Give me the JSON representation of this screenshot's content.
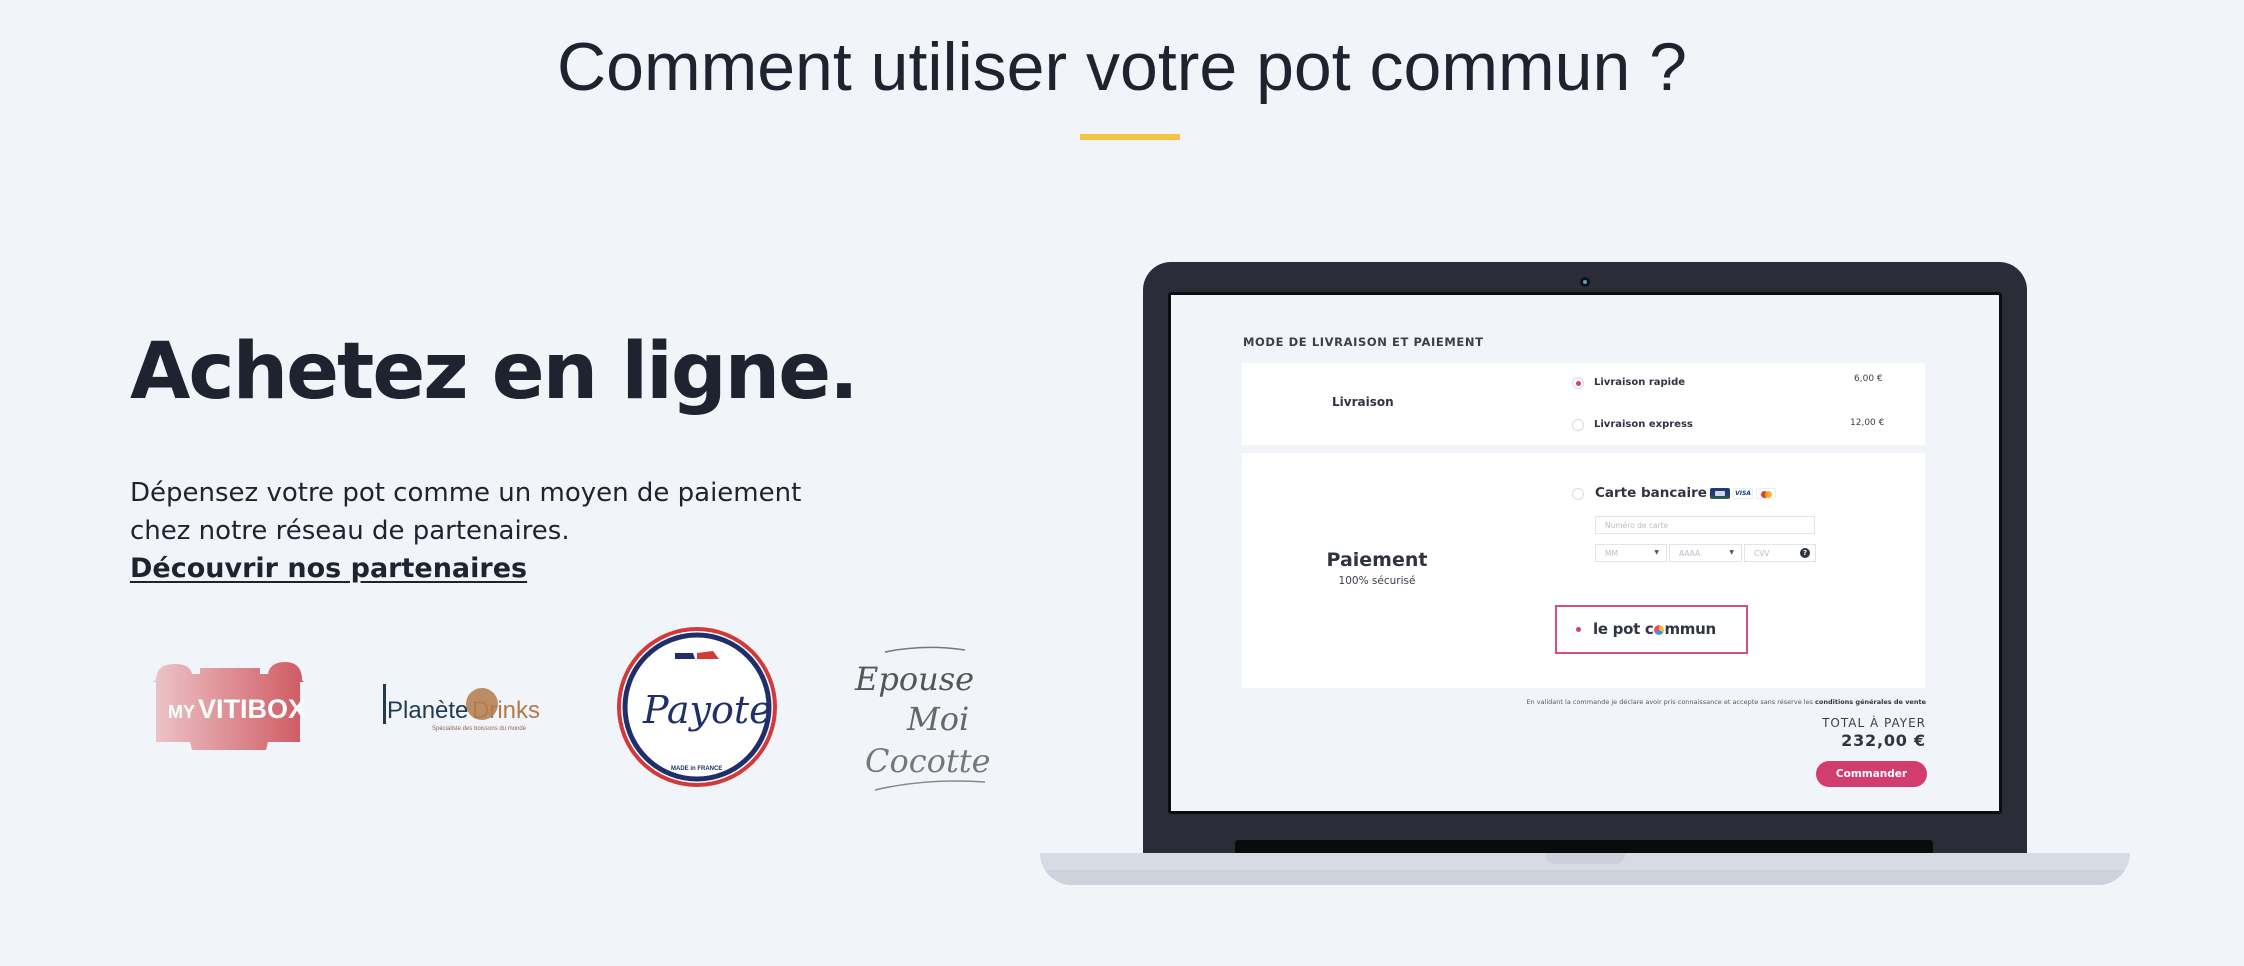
{
  "section": {
    "title": "Comment utiliser votre pot commun ?",
    "accent_color": "#f4c542"
  },
  "left": {
    "headline": "Achetez en ligne.",
    "description_line1": "Dépensez votre pot comme un moyen de paiement",
    "description_line2": "chez notre réseau de partenaires.",
    "partners_link": "Découvrir nos partenaires"
  },
  "partners": [
    {
      "name": "My Vitibox",
      "line1": "MY",
      "line2": "VITIBOX"
    },
    {
      "name": "Planète Drinks",
      "word1": "Planète",
      "word2": "Drinks",
      "tagline": "Spécialiste des boissons du monde"
    },
    {
      "name": "Payote",
      "script": "Payote",
      "made_in": "MADE in FRANCE"
    },
    {
      "name": "Epouse Moi Cocotte",
      "line1": "Epouse",
      "line2": "Moi",
      "line3": "Cocotte"
    }
  ],
  "checkout": {
    "title": "MODE DE LIVRAISON ET PAIEMENT",
    "delivery": {
      "label": "Livraison",
      "options": [
        {
          "label": "Livraison rapide",
          "price": "6,00 €",
          "selected": true
        },
        {
          "label": "Livraison express",
          "price": "12,00 €",
          "selected": false
        }
      ]
    },
    "payment": {
      "label": "Paiement",
      "sublabel": "100% sécurisé",
      "card_option": {
        "label": "Carte bancaire",
        "selected": false,
        "icons": [
          "cb-card-icon",
          "visa-card-icon",
          "mastercard-icon"
        ],
        "visa_text": "VISA",
        "card_number_placeholder": "Numéro de carte",
        "month_placeholder": "MM",
        "year_placeholder": "AAAA",
        "cvv_placeholder": "CVV",
        "help_icon": "?"
      },
      "potcommun_option": {
        "label_before": "le pot c",
        "label_after": "mmun",
        "selected": true
      }
    },
    "cgv_text": "En validant la commande je déclare avoir pris connaissance et accepte sans réserve les",
    "cgv_link": "conditions générales de vente",
    "total_label": "TOTAL À PAYER",
    "total_value": "232,00 €",
    "submit_label": "Commander",
    "accent_color": "#d23d70"
  }
}
